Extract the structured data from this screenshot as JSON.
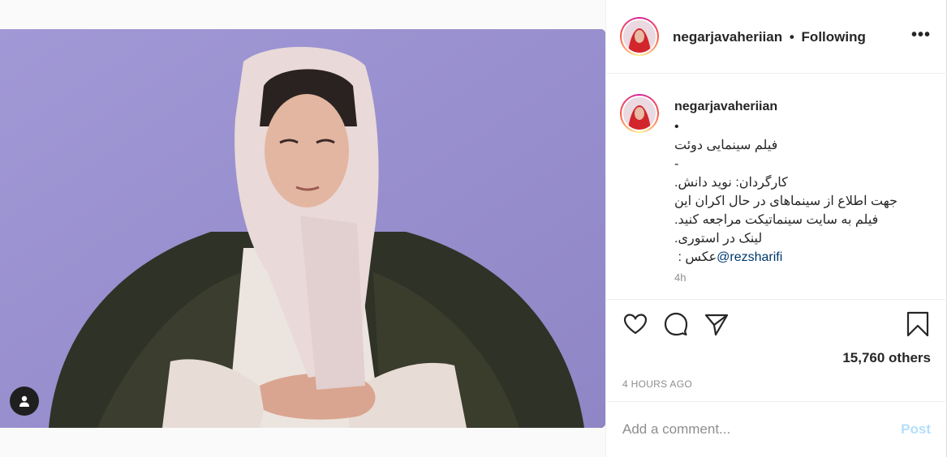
{
  "header": {
    "username": "negarjavaheriian",
    "separator": "•",
    "follow_status": "Following",
    "more_label": "•••"
  },
  "caption": {
    "username": "negarjavaheriian",
    "lines": [
      "•",
      "فیلم سینمایی دوئت",
      "-",
      "کارگردان: نوید دانش.",
      "جهت اطلاع از سینماهای در حال اکران این",
      "فیلم به سایت سینماتیکت مراجعه کنید.",
      "لینک در استوری."
    ],
    "credit_prefix": "عکس : ",
    "credit_mention": "@rezsharifi",
    "time": "4h"
  },
  "actions": {
    "like_icon": "heart-icon",
    "comment_icon": "comment-bubble-icon",
    "share_icon": "paper-plane-icon",
    "save_icon": "bookmark-icon"
  },
  "likes_text": "15,760 others",
  "post_time": "4 HOURS AGO",
  "comment": {
    "placeholder": "Add a comment...",
    "post_label": "Post"
  },
  "colors": {
    "backdrop": "#9b90cf",
    "link": "#00376b",
    "post_disabled": "#b2dffc"
  }
}
